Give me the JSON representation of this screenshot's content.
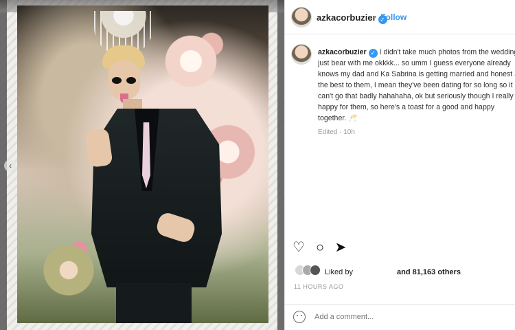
{
  "post": {
    "account": "azkacorbuzier",
    "verified_mark": "✓",
    "follow_label": "Follow",
    "caption": "I didn't take much photos from the wedding just bear with me okkkk... so umm I guess everyone already knows my dad and Ka Sabrina is getting married and honest all the best to them, I mean they've been dating for so long so it can't go that badly hahahaha, ok but seriously though I really happy for them, so here's a toast for a good and happy together. 🥂",
    "edited": "Edited · 10h",
    "liked_by": "Liked by",
    "likes_other": "and 81,163 others",
    "time": "11 HOURS AGO",
    "comment_placeholder": "Add a comment..."
  },
  "icons": {
    "like": "heart-icon",
    "comment": "comment-icon",
    "share": "share-icon",
    "emoji": "emoji-icon",
    "carousel_prev": "chevron-left-icon"
  },
  "colors": {
    "follow": "#3897f0",
    "verified": "#3897f0"
  }
}
